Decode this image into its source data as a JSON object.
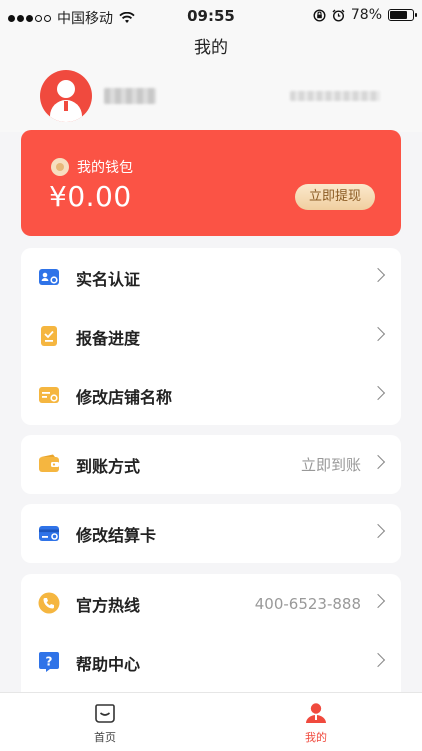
{
  "status_bar": {
    "carrier": "中国移动",
    "time": "09:55",
    "battery": "78%",
    "battery_level": 0.78
  },
  "nav": {
    "title": "我的"
  },
  "wallet": {
    "title": "我的钱包",
    "amount": "¥0.00",
    "withdraw_label": "立即提现"
  },
  "menu_group1": [
    {
      "label": "实名认证",
      "icon": "id-card-icon"
    },
    {
      "label": "报备进度",
      "icon": "clipboard-check-icon"
    },
    {
      "label": "修改店铺名称",
      "icon": "store-edit-icon"
    }
  ],
  "menu_group2": [
    {
      "label": "到账方式",
      "value": "立即到账",
      "icon": "wallet-icon"
    }
  ],
  "menu_group3": [
    {
      "label": "修改结算卡",
      "icon": "bank-card-icon"
    }
  ],
  "menu_group4": [
    {
      "label": "官方热线",
      "value": "400-6523-888",
      "icon": "phone-icon"
    },
    {
      "label": "帮助中心",
      "icon": "help-icon"
    }
  ],
  "tabbar": {
    "home_label": "首页",
    "mine_label": "我的"
  },
  "colors": {
    "accent": "#f04a3e",
    "wallet_bg": "#fb5345",
    "icon_blue": "#2f73e8",
    "icon_orange": "#f5b640"
  }
}
